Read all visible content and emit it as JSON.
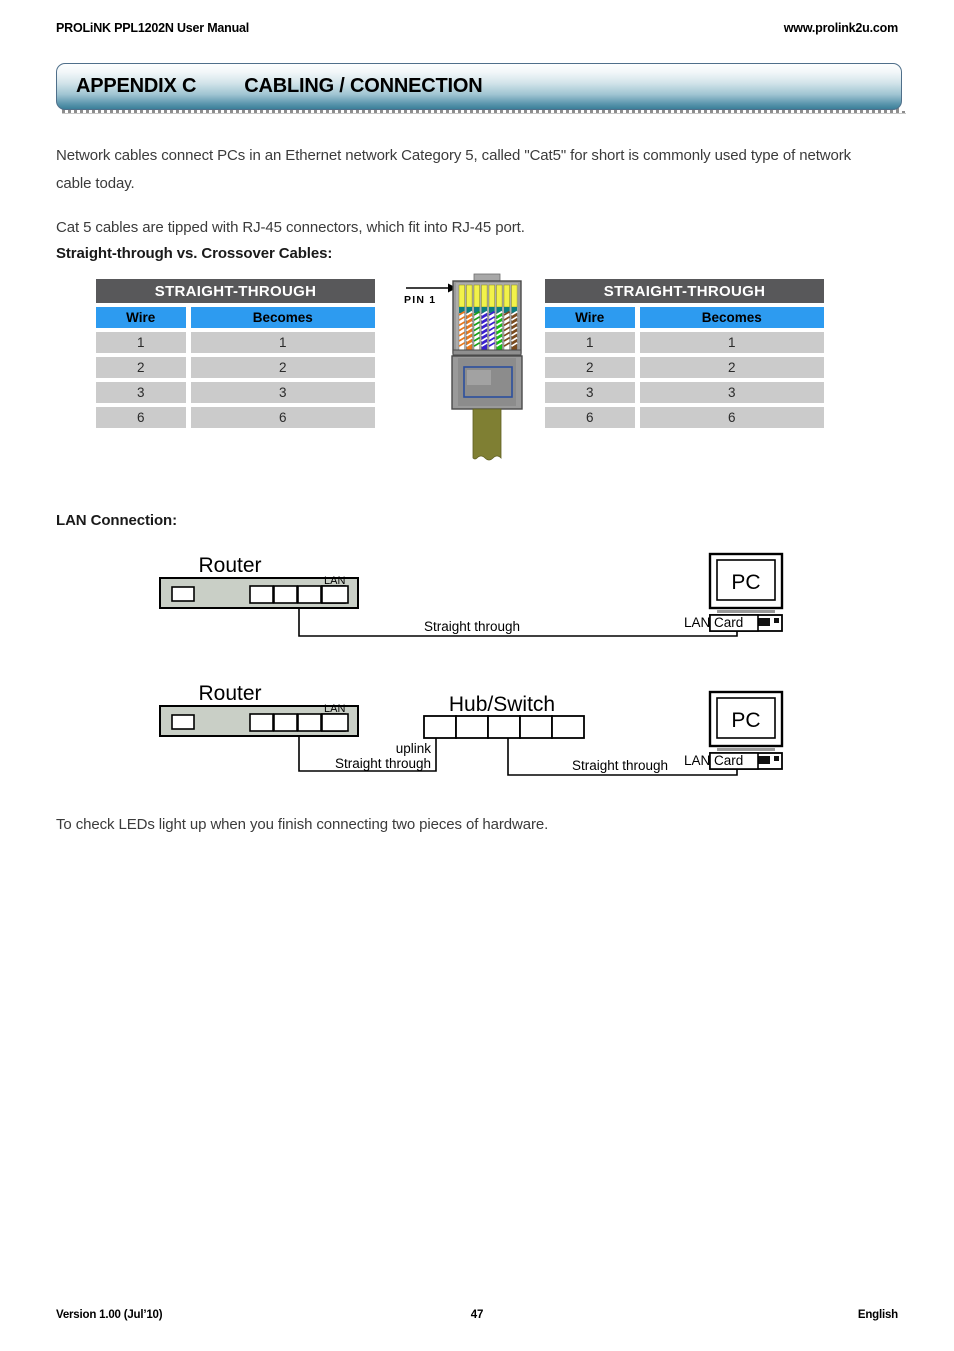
{
  "header": {
    "manual_title": "PROLiNK PPL1202N User Manual",
    "website": "www.prolink2u.com"
  },
  "title_bar": {
    "appendix_label": "APPENDIX C",
    "appendix_title": "CABLING / CONNECTION"
  },
  "body": {
    "intro": "Network cables connect PCs in an Ethernet network Category 5, called \"Cat5\" for short is commonly used type of network cable today.",
    "cat5_note": "Cat 5 cables are tipped with RJ-45 connectors, which fit into RJ-45 port.",
    "straight_vs_crossover_label": "Straight-through vs. Crossover Cables:",
    "lan_connection_label": "LAN Connection:",
    "leds_note": "To check LEDs light up when you finish connecting two pieces of hardware."
  },
  "tables": {
    "left": {
      "title": "STRAIGHT-THROUGH",
      "columns": [
        "Wire",
        "Becomes"
      ],
      "rows": [
        [
          "1",
          "1"
        ],
        [
          "2",
          "2"
        ],
        [
          "3",
          "3"
        ],
        [
          "6",
          "6"
        ]
      ]
    },
    "right": {
      "title": "STRAIGHT-THROUGH",
      "columns": [
        "Wire",
        "Becomes"
      ],
      "rows": [
        [
          "1",
          "1"
        ],
        [
          "2",
          "2"
        ],
        [
          "3",
          "3"
        ],
        [
          "6",
          "6"
        ]
      ]
    }
  },
  "rj45": {
    "pin1_label": "PIN 1",
    "pin_count": 8,
    "wire_colors": [
      {
        "name": "white-orange",
        "base": "#ffffff",
        "stripe": "#e8781e"
      },
      {
        "name": "orange",
        "base": "#e8781e",
        "stripe": "#ffffff"
      },
      {
        "name": "white-green",
        "base": "#ffffff",
        "stripe": "#16a016"
      },
      {
        "name": "blue",
        "base": "#3a1fd0",
        "stripe": "#ffffff"
      },
      {
        "name": "white-blue",
        "base": "#ffffff",
        "stripe": "#3a1fd0"
      },
      {
        "name": "green",
        "base": "#16c016",
        "stripe": "#ffffff"
      },
      {
        "name": "white-brown",
        "base": "#ffffff",
        "stripe": "#7a4b1e"
      },
      {
        "name": "brown",
        "base": "#7a4b1e",
        "stripe": "#ffffff"
      }
    ],
    "pin_color": "#f2f24a",
    "contact_color": "#0f7d7d",
    "body_color": "#8f8f8f",
    "jacket_color": "#7f7f33"
  },
  "diagram1": {
    "router_label": "Router",
    "router_lan_label": "LAN",
    "router_port_count": 4,
    "cable_label": "Straight through",
    "pc_label": "PC",
    "lan_card_label": "LAN Card"
  },
  "diagram2": {
    "router_label": "Router",
    "router_lan_label": "LAN",
    "router_port_count": 4,
    "hub_label": "Hub/Switch",
    "hub_port_count": 5,
    "uplink_label": "uplink",
    "cable_label_left": "Straight through",
    "cable_label_right": "Straight through",
    "pc_label": "PC",
    "lan_card_label": "LAN Card"
  },
  "footer": {
    "version": "Version 1.00 (Jul’10)",
    "page_number": "47",
    "language": "English"
  }
}
